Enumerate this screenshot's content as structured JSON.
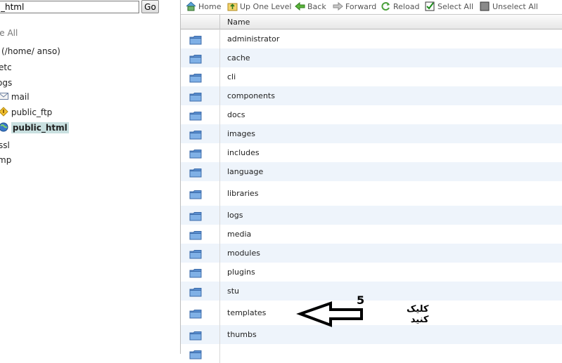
{
  "left_pane": {
    "path_value": "_html",
    "go_label": "Go",
    "collapse_all": "se All",
    "tree": [
      {
        "label": "(/home/       anso)",
        "icon": "none",
        "top": 0
      },
      {
        "label": "etc",
        "icon": "none"
      },
      {
        "label": "ogs",
        "icon": "none"
      },
      {
        "label": "mail",
        "icon": "mail-icon"
      },
      {
        "label": "public_ftp",
        "icon": "ftp-icon"
      },
      {
        "label": "public_html",
        "icon": "globe-icon",
        "selected": true
      },
      {
        "label": "ssl",
        "icon": "none"
      },
      {
        "label": "mp",
        "icon": "none"
      }
    ]
  },
  "toolbar": {
    "home": "Home",
    "up": "Up One Level",
    "back": "Back",
    "forward": "Forward",
    "reload": "Reload",
    "select_all": "Select All",
    "unselect_all": "Unselect All"
  },
  "table": {
    "header_name": "Name",
    "rows": [
      "administrator",
      "cache",
      "cli",
      "components",
      "docs",
      "images",
      "includes",
      "language",
      "libraries",
      "logs",
      "media",
      "modules",
      "plugins",
      "stu",
      "templates",
      "thumbs",
      ""
    ]
  },
  "annotation": {
    "step": "5",
    "label": "کلیک کنید"
  },
  "colors": {
    "selected_bg": "#c9e0e0",
    "row_alt": "#eef4fb",
    "folder": "#5b8fd0"
  }
}
